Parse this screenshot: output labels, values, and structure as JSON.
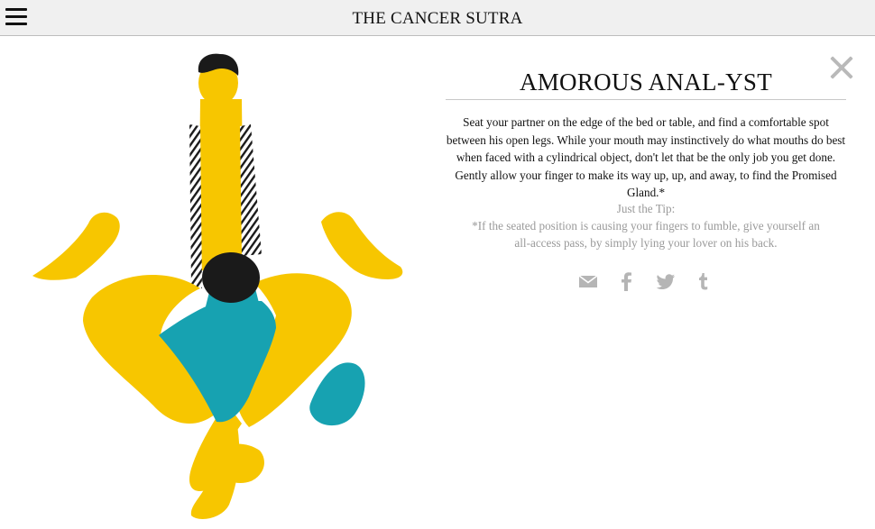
{
  "header": {
    "site_title": "THE CANCER SUTRA",
    "menu_icon": "hamburger-menu-icon"
  },
  "illustration": {
    "icon": "illustration-figures",
    "colors": {
      "skin": "#f7c600",
      "shirt": "#17a2b1",
      "hair": "#1a1a1a",
      "tie": "#1a1a1a"
    }
  },
  "panel": {
    "close_icon": "close-icon",
    "title": "AMOROUS ANAL-YST",
    "description": "Seat your partner on the edge of the bed or table, and find a comfortable spot between his open legs. While your mouth may instinctively do what mouths do best when faced with a cylindrical object, don't let that be the only job you get done. Gently allow your finger to make its way up, up, and away, to find the Promised Gland.*",
    "tip_heading": "Just the Tip:",
    "tip_body": "*If the seated position is causing your fingers to fumble, give yourself an all-access pass, by simply lying your lover on his back.",
    "share": [
      {
        "icon": "email-icon"
      },
      {
        "icon": "facebook-icon"
      },
      {
        "icon": "twitter-icon"
      },
      {
        "icon": "tumblr-icon"
      }
    ]
  },
  "colors": {
    "text": "#111111",
    "muted": "#9a9a9a",
    "icon": "#b5b5b5",
    "topbar": "#f0f0f0"
  }
}
